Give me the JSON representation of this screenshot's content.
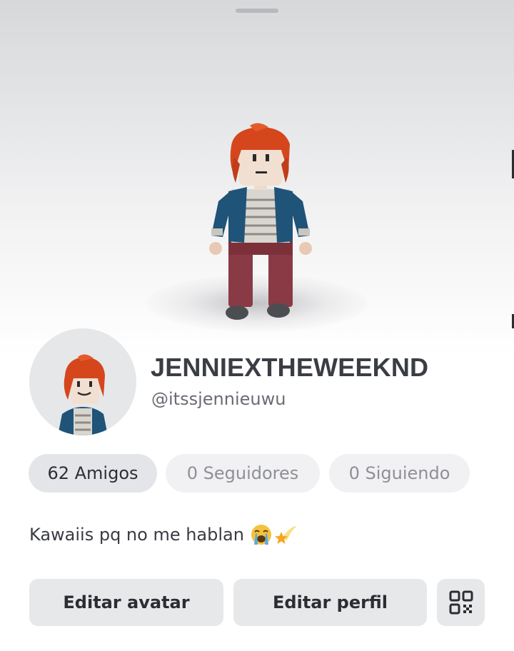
{
  "profile": {
    "display_name": "JENNIEXTHEWEEKND",
    "username": "@itssjennieuwu",
    "bio": "Kawaiis pq no me hablan",
    "bio_emojis": [
      "loudly-crying-face-icon",
      "shooting-star-icon"
    ]
  },
  "stats": {
    "friends_label": "62 Amigos",
    "followers_label": "0 Seguidores",
    "following_label": "0 Siguiendo"
  },
  "actions": {
    "edit_avatar_label": "Editar avatar",
    "edit_profile_label": "Editar perfil",
    "qr_icon": "qr-code-icon"
  },
  "colors": {
    "hair": "#d5461d",
    "jacket": "#1f5378",
    "pants": "#8d3a42",
    "button_bg": "#e7e8ea",
    "text_primary": "#3b3d45",
    "text_secondary": "#6a6c74"
  }
}
